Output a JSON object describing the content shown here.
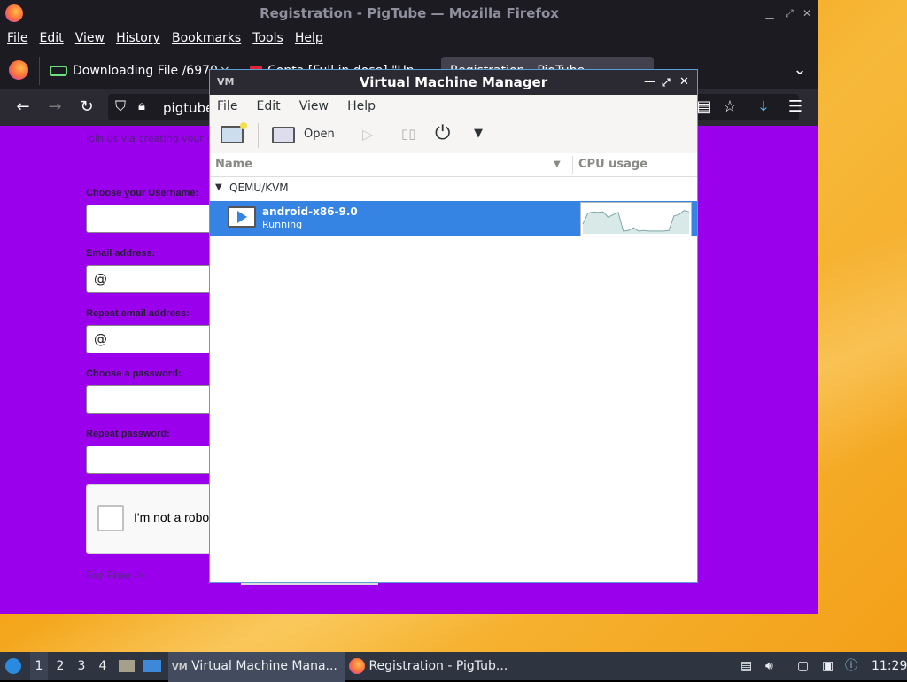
{
  "firefox": {
    "title": "Registration - PigTube — Mozilla Firefox",
    "menu": [
      "File",
      "Edit",
      "View",
      "History",
      "Bookmarks",
      "Tools",
      "Help"
    ],
    "tabs": [
      {
        "label": "Downloading File /6970"
      },
      {
        "label": "Conta [Full in dose] \"Un"
      },
      {
        "label": "Registration - PigTube"
      }
    ],
    "url": "pigtube",
    "page": {
      "faded_text": "Join us via creating your account",
      "fields": [
        {
          "label": "Choose your Username:",
          "value": ""
        },
        {
          "label": "Email address:",
          "value": "@"
        },
        {
          "label": "Repeat email address:",
          "value": "@"
        },
        {
          "label": "Choose a password:",
          "value": ""
        },
        {
          "label": "Repeat password:",
          "value": ""
        }
      ],
      "captcha_text": "I'm not a robo",
      "free_link": "For Free ->"
    }
  },
  "vmm": {
    "title": "Virtual Machine Manager",
    "menu": [
      "File",
      "Edit",
      "View",
      "Help"
    ],
    "toolbar": {
      "open_label": "Open"
    },
    "columns": {
      "name": "Name",
      "cpu": "CPU usage"
    },
    "group": "QEMU/KVM",
    "vm": {
      "name": "android-x86-9.0",
      "status": "Running"
    },
    "cpu_history": [
      0.35,
      0.75,
      0.8,
      0.78,
      0.8,
      0.6,
      0.7,
      0.78,
      0.1,
      0.12,
      0.22,
      0.1,
      0.12,
      0.1,
      0.1,
      0.1,
      0.1,
      0.12,
      0.65,
      0.7,
      0.85,
      0.8
    ]
  },
  "taskbar": {
    "workspaces": [
      "1",
      "2",
      "3",
      "4"
    ],
    "tasks": [
      {
        "label": "Virtual Machine Mana..."
      },
      {
        "label": "Registration - PigTub..."
      }
    ],
    "clock": "11:29"
  }
}
